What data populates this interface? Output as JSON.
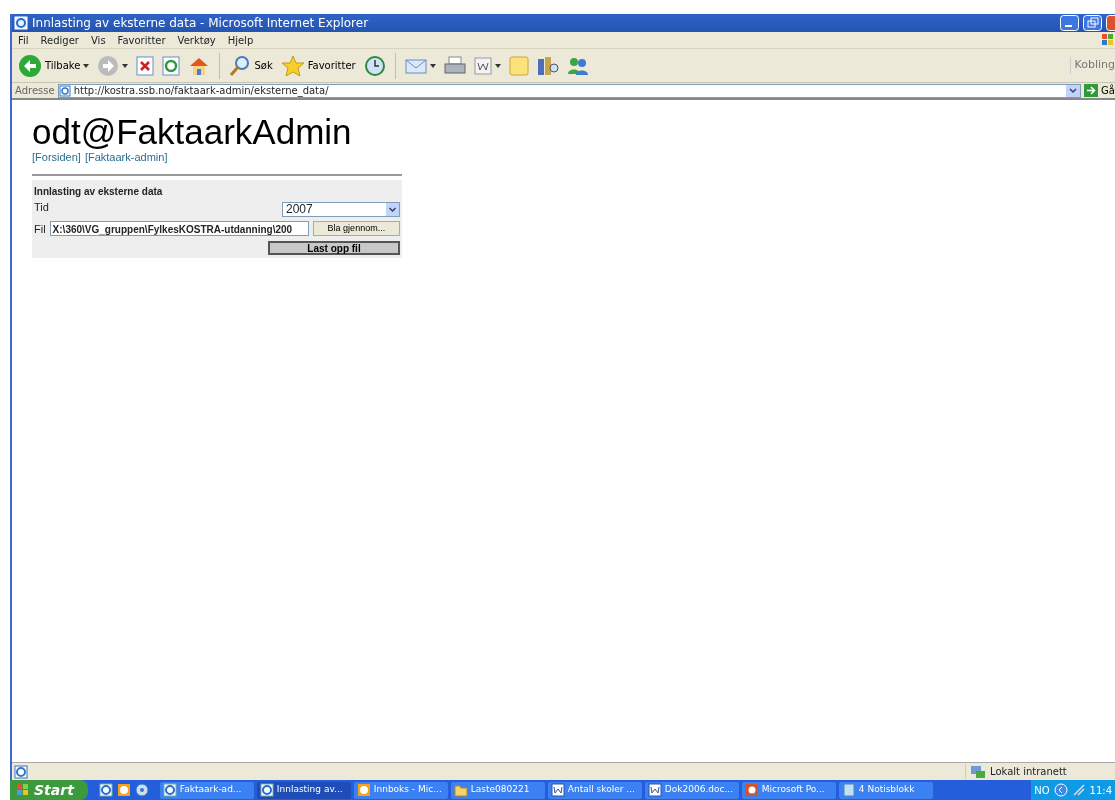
{
  "window": {
    "title": "Innlasting av eksterne data - Microsoft Internet Explorer"
  },
  "menu": [
    "Fil",
    "Rediger",
    "Vis",
    "Favoritter",
    "Verktøy",
    "Hjelp"
  ],
  "toolbar": [
    {
      "kind": "back",
      "label": "Tilbake",
      "dropdown": true
    },
    {
      "kind": "forward",
      "dropdown": true
    },
    {
      "kind": "stop"
    },
    {
      "kind": "refresh"
    },
    {
      "kind": "home"
    },
    {
      "kind": "separator"
    },
    {
      "kind": "search",
      "label": "Søk"
    },
    {
      "kind": "favorites",
      "label": "Favoritter"
    },
    {
      "kind": "history"
    },
    {
      "kind": "separator"
    },
    {
      "kind": "mail",
      "dropdown": true
    },
    {
      "kind": "print"
    },
    {
      "kind": "word",
      "dropdown": true
    },
    {
      "kind": "note"
    },
    {
      "kind": "research"
    },
    {
      "kind": "messenger"
    }
  ],
  "links_label": "Kobling",
  "address": {
    "label": "Adresse",
    "url": "http://kostra.ssb.no/faktaark-admin/eksterne_data/",
    "go": "Gå"
  },
  "page": {
    "heading": "odt@FaktaarkAdmin",
    "nav_links": [
      "[Forsiden]",
      "[Faktaark-admin]"
    ],
    "form": {
      "title": "Innlasting av eksterne data",
      "tid_label": "Tid",
      "tid_value": "2007",
      "fil_label": "Fil",
      "fil_value": "X:\\360\\VG_gruppen\\FylkesKOSTRA-utdanning\\200",
      "browse": "Bla gjennom...",
      "submit": "Last opp fil"
    }
  },
  "status_bar": {
    "zone": "Lokalt intranett"
  },
  "taskbar": {
    "start": "Start",
    "quick_launch": [
      {
        "kind": "ie"
      },
      {
        "kind": "outlook"
      },
      {
        "kind": "media"
      }
    ],
    "tasks": [
      {
        "label": "Faktaark-ad...",
        "kind": "ie",
        "selected": false
      },
      {
        "label": "Innlasting av...",
        "kind": "ie",
        "selected": true
      },
      {
        "label": "Innboks - Mic...",
        "kind": "outlook",
        "selected": false
      },
      {
        "label": "Laste080221",
        "kind": "folder",
        "selected": false
      },
      {
        "label": "Antall skoler ...",
        "kind": "word",
        "selected": false
      },
      {
        "label": "Dok2006.doc...",
        "kind": "word",
        "selected": false
      },
      {
        "label": "Microsoft Po...",
        "kind": "powerpoint",
        "selected": false
      },
      {
        "label": "4 Notisblokk",
        "kind": "notepad",
        "selected": false
      }
    ],
    "language": "NO",
    "clock": "11:4"
  }
}
